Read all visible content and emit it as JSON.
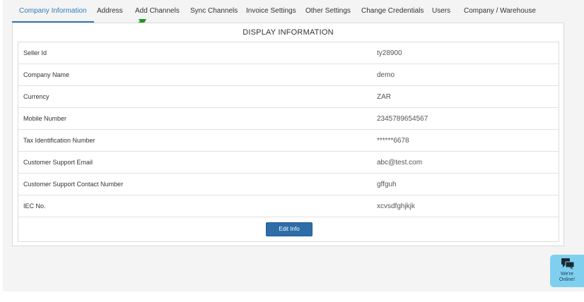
{
  "tabs": [
    {
      "label": "Company Information",
      "active": true
    },
    {
      "label": "Address"
    },
    {
      "label": "Add Channels"
    },
    {
      "label": "Sync Channels"
    },
    {
      "label": "Invoice Settings"
    },
    {
      "label": "Other Settings"
    },
    {
      "label": "Change Credentials"
    },
    {
      "label": "Users"
    },
    {
      "label": "Company / Warehouse"
    }
  ],
  "panel": {
    "title": "DISPLAY INFORMATION",
    "rows": [
      {
        "label": "Seller Id",
        "value": "ty28900"
      },
      {
        "label": "Company Name",
        "value": "demo"
      },
      {
        "label": "Currency",
        "value": "ZAR"
      },
      {
        "label": "Mobile Number",
        "value": "2345789654567"
      },
      {
        "label": "Tax Identification Number",
        "value": "******6678"
      },
      {
        "label": "Customer Support Email",
        "value": "abc@test.com"
      },
      {
        "label": "Customer Support Contact Number",
        "value": "gffguh"
      },
      {
        "label": "IEC No.",
        "value": "xcvsdfghjkjk"
      }
    ],
    "edit_label": "Edit Info"
  },
  "chat": {
    "label": "We're\nOnline!",
    "icon": "chat-bubbles-icon"
  },
  "colors": {
    "accent": "#337ab7",
    "button": "#2f6da8",
    "arrow": "#1a9a1a",
    "chat_bg": "#7fd0ef"
  }
}
